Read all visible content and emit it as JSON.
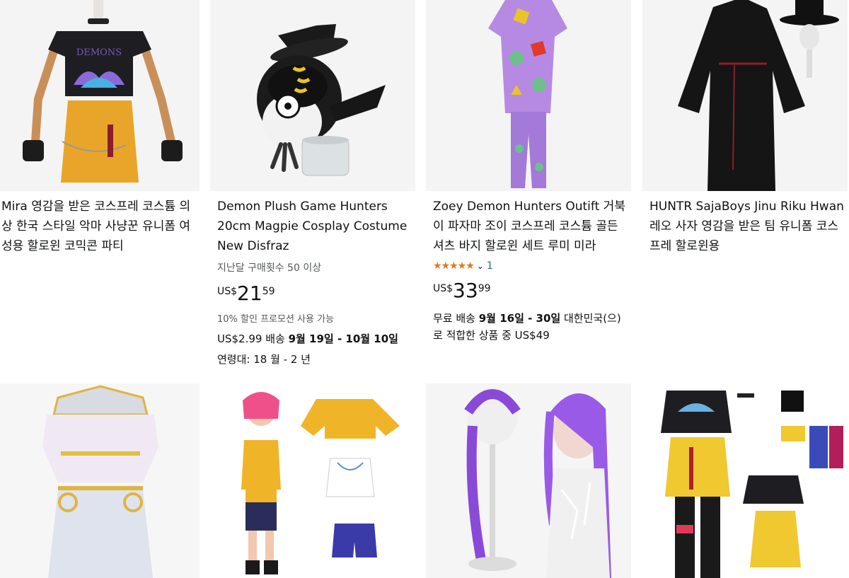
{
  "products": [
    {
      "title": "Mira 영감을 받은 코스프레 코스튬 의상 한국 스타일 악마 사냥꾼 유니폼 여성용 할로윈 코믹콘 파티",
      "image_icon": "mannequin-crop-top-yellow-skirt"
    },
    {
      "title": "Demon Plush Game Hunters 20cm Magpie Cosplay Costume New Disfraz",
      "bought": "지난달 구매횟수 50 이상",
      "price_currency": "US$",
      "price_whole": "21",
      "price_fraction": "59",
      "promo": "10% 할인 프로모션 사용 가능",
      "shipping_prefix": "US$2.99 배송 ",
      "shipping_dates": "9월 19일 - 10월 10일",
      "age": "연령대: 18 월 - 2 년",
      "image_icon": "magpie-plush-with-hat"
    },
    {
      "title": "Zoey Demon Hunters Outift 거북이 파자마 조이 코스프레 코스튬 골든 셔츠 바지 할로윈 세트 루미 미라",
      "stars": "★★★★★",
      "rating_count": "1",
      "price_currency": "US$",
      "price_whole": "33",
      "price_fraction": "99",
      "shipping_prefix": "무료 배송 ",
      "shipping_dates": "9월 16일 - 30일",
      "shipping_suffix": " 대한민국(으)로 적합한 상품 중 US$49",
      "image_icon": "purple-pajama-set"
    },
    {
      "title": "HUNTR SajaBoys Jinu Riku Hwan 레오 사자 영감을 받은 팀 유니폼 코스프레 할로윈용",
      "image_icon": "black-robe-and-gat-hat"
    },
    {
      "image_icon": "white-gold-armor-outfit"
    },
    {
      "image_icon": "girl-yellow-jacket-set"
    },
    {
      "image_icon": "purple-braid-wig"
    },
    {
      "image_icon": "crop-top-skirt-accessory-set"
    }
  ],
  "colors": {
    "star": "#de7921",
    "link": "#2162a1",
    "text": "#0f1111",
    "muted": "#565959"
  }
}
